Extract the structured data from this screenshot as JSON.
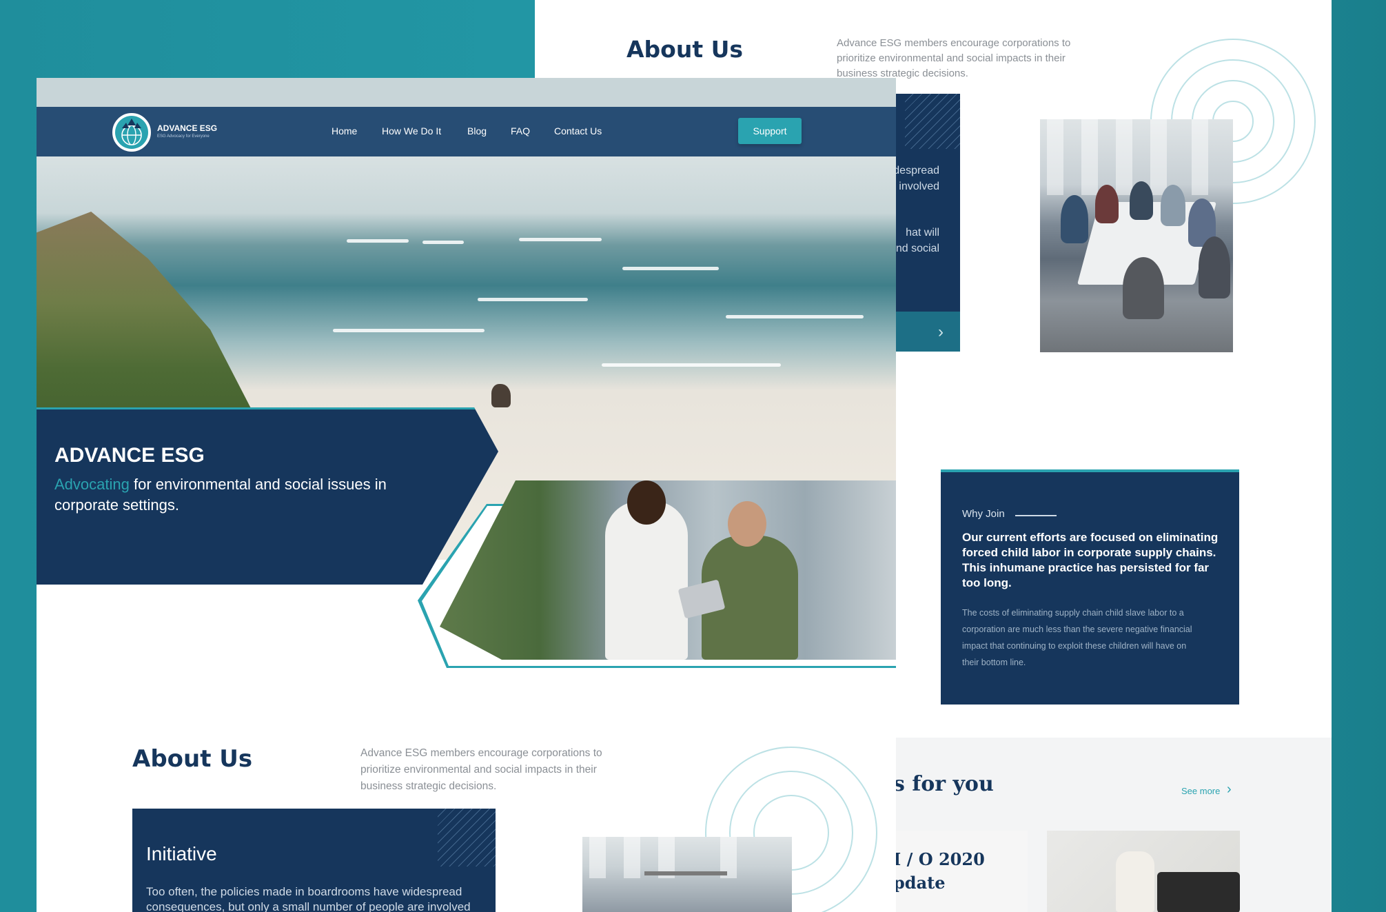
{
  "back_page": {
    "about_title": "About Us",
    "about_desc": "Advance ESG members encourage corporations to prioritize environmental and social impacts in their business strategic decisions.",
    "card_text_1": "despread\nre involved",
    "card_text_2": "hat will\nand social",
    "why_join": {
      "label": "Why Join",
      "headline": "Our current efforts are focused on eliminating forced child labor in corporate supply chains. This inhumane practice has persisted for far too long.",
      "body": "The costs of eliminating supply chain child slave labor to a corporation are much less than the severe negative financial impact that continuing to exploit these children will have on their bottom line."
    },
    "for_you_heading": "s for you",
    "see_more": "See more",
    "update_title": "I / O 2020\npdate"
  },
  "front_page": {
    "nav": {
      "logo_text": "ADVANCE ESG",
      "logo_sub": "ESG Advocacy for Everyone",
      "links": [
        "Home",
        "How We Do It",
        "Blog",
        "FAQ",
        "Contact Us"
      ],
      "support_label": "Support"
    },
    "hero": {
      "title": "ADVANCE ESG",
      "accent_word": "Advocating",
      "subtitle_rest": " for environmental and social issues in corporate settings."
    },
    "about": {
      "title": "About Us",
      "desc": "Advance ESG members encourage corporations to prioritize environmental and social impacts in their business strategic decisions."
    },
    "initiative": {
      "title": "Initiative",
      "text": "Too often, the policies made in boardrooms have widespread consequences, but only a small number of people are involved"
    }
  },
  "colors": {
    "navy": "#16365c",
    "nav_bar": "#274d74",
    "teal_accent": "#2aa3b0",
    "background_teal": "#2196a4"
  },
  "icons": {
    "logo": "globe-tree-icon",
    "chevron": "chevron-right-icon"
  }
}
